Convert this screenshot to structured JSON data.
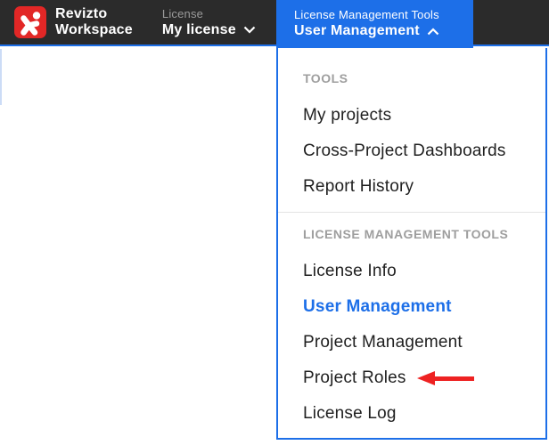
{
  "topbar": {
    "brand": {
      "line1": "Revizto",
      "line2": "Workspace"
    },
    "license_switcher": {
      "label": "License",
      "value": "My license"
    },
    "active_tab": {
      "label": "License Management Tools",
      "value": "User Management"
    }
  },
  "menu": {
    "sections": [
      {
        "header": "TOOLS",
        "items": [
          {
            "label": "My projects"
          },
          {
            "label": "Cross-Project Dashboards"
          },
          {
            "label": "Report History"
          }
        ]
      },
      {
        "header": "LICENSE MANAGEMENT TOOLS",
        "items": [
          {
            "label": "License Info"
          },
          {
            "label": "User Management",
            "active": true
          },
          {
            "label": "Project Management"
          },
          {
            "label": "Project Roles",
            "annotated_with_arrow": true
          },
          {
            "label": "License Log"
          }
        ]
      }
    ]
  },
  "colors": {
    "topbar_background": "#2b2b2b",
    "accent_blue": "#1d6fe8",
    "brand_logo_red": "#e22726",
    "annotation_arrow_red": "#ee2222",
    "section_header_gray": "#9e9e9e",
    "menu_item_text": "#1f1f1f",
    "divider_gray": "#e4e4e4"
  }
}
